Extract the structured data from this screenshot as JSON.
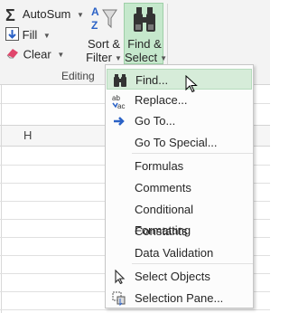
{
  "ribbon": {
    "autosum_label": "AutoSum",
    "fill_label": "Fill",
    "clear_label": "Clear",
    "sort_line1": "Sort &",
    "sort_line2": "Filter",
    "find_line1": "Find &",
    "find_line2": "Select",
    "group_label": "Editing"
  },
  "sheet": {
    "column_header": "H"
  },
  "menu": {
    "items": [
      {
        "label": "Find...",
        "icon": "binoculars-icon"
      },
      {
        "label": "Replace...",
        "icon": "replace-icon"
      },
      {
        "label": "Go To...",
        "icon": "arrow-right-icon"
      },
      {
        "label": "Go To Special...",
        "icon": ""
      },
      {
        "label": "Formulas",
        "icon": ""
      },
      {
        "label": "Comments",
        "icon": ""
      },
      {
        "label": "Conditional Formatting",
        "icon": ""
      },
      {
        "label": "Constants",
        "icon": ""
      },
      {
        "label": "Data Validation",
        "icon": ""
      },
      {
        "label": "Select Objects",
        "icon": "select-objects-icon"
      },
      {
        "label": "Selection Pane...",
        "icon": "selection-pane-icon"
      }
    ]
  },
  "colors": {
    "highlight": "#d6ecd9",
    "button_active": "#c5e8cc",
    "accent_blue": "#2b62c6"
  }
}
